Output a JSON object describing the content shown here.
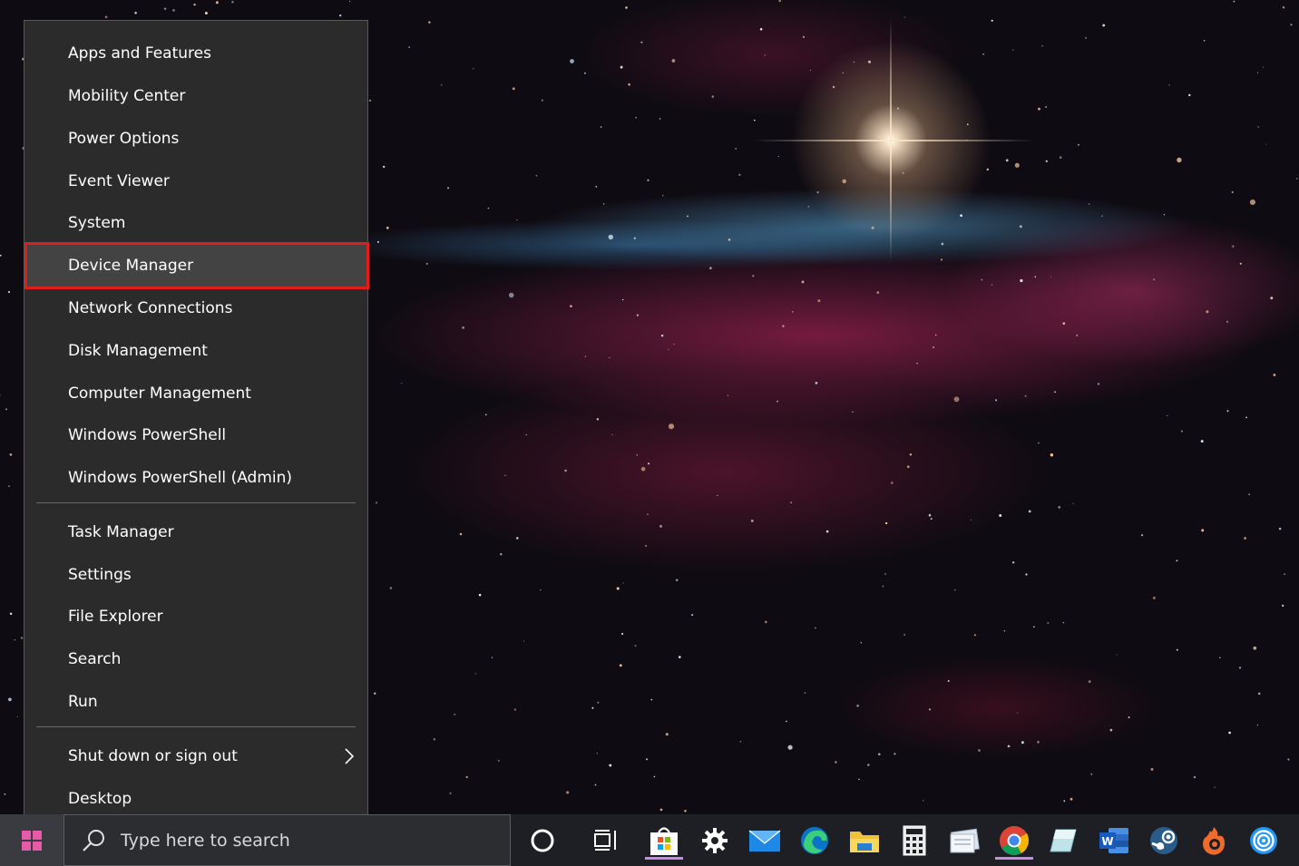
{
  "menu": {
    "items_group1": [
      {
        "label": "Apps and Features",
        "name": "menu-item-apps-and-features"
      },
      {
        "label": "Mobility Center",
        "name": "menu-item-mobility-center"
      },
      {
        "label": "Power Options",
        "name": "menu-item-power-options"
      },
      {
        "label": "Event Viewer",
        "name": "menu-item-event-viewer"
      },
      {
        "label": "System",
        "name": "menu-item-system"
      },
      {
        "label": "Device Manager",
        "name": "menu-item-device-manager",
        "selected": true
      },
      {
        "label": "Network Connections",
        "name": "menu-item-network-connections"
      },
      {
        "label": "Disk Management",
        "name": "menu-item-disk-management"
      },
      {
        "label": "Computer Management",
        "name": "menu-item-computer-management"
      },
      {
        "label": "Windows PowerShell",
        "name": "menu-item-windows-powershell"
      },
      {
        "label": "Windows PowerShell (Admin)",
        "name": "menu-item-windows-powershell-admin"
      }
    ],
    "items_group2": [
      {
        "label": "Task Manager",
        "name": "menu-item-task-manager"
      },
      {
        "label": "Settings",
        "name": "menu-item-settings"
      },
      {
        "label": "File Explorer",
        "name": "menu-item-file-explorer"
      },
      {
        "label": "Search",
        "name": "menu-item-search"
      },
      {
        "label": "Run",
        "name": "menu-item-run"
      }
    ],
    "items_group3": [
      {
        "label": "Shut down or sign out",
        "name": "menu-item-shut-down-or-sign-out",
        "has_submenu": true
      },
      {
        "label": "Desktop",
        "name": "menu-item-desktop"
      }
    ],
    "highlight_color": "#e21b1b"
  },
  "taskbar": {
    "search_placeholder": "Type here to search",
    "icons": [
      "cortana-icon",
      "task-view-icon",
      "microsoft-store-icon",
      "settings-gear-icon",
      "mail-icon",
      "edge-icon",
      "file-explorer-icon",
      "calculator-icon",
      "notepad-icon",
      "chrome-icon",
      "paint-icon",
      "word-icon",
      "steam-icon",
      "firefox-icon",
      "app-spiral-icon"
    ]
  }
}
